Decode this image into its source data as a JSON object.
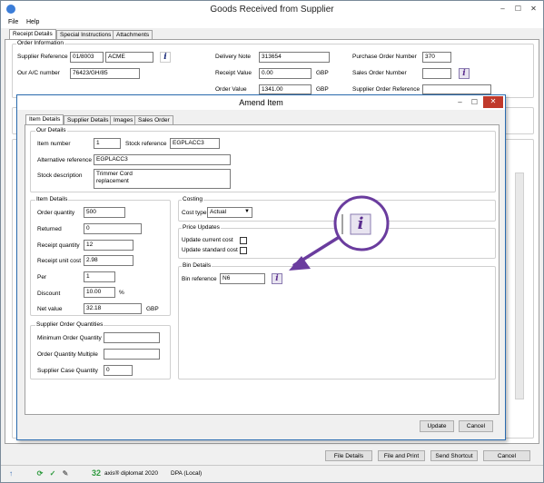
{
  "window": {
    "title": "Goods Received from Supplier",
    "minimize": "–",
    "maximize": "☐",
    "close": "✕"
  },
  "menu": [
    "File",
    "Help"
  ],
  "tabs": [
    "Receipt Details",
    "Special Instructions",
    "Attachments"
  ],
  "order_info": {
    "group_title": "Order Information",
    "supplier_reference_label": "Supplier Reference",
    "supplier_reference_code": "01/8003",
    "supplier_reference_name": "ACME",
    "our_ac_label": "Our A/C number",
    "our_ac_value": "76423/GH/85",
    "delivery_note_label": "Delivery Note",
    "delivery_note_value": "313654",
    "receipt_value_label": "Receipt Value",
    "receipt_value_value": "0.00",
    "receipt_value_ccy": "GBP",
    "order_value_label": "Order Value",
    "order_value_value": "1341.00",
    "order_value_ccy": "GBP",
    "po_number_label": "Purchase Order Number",
    "po_number_value": "370",
    "sales_order_label": "Sales Order Number",
    "sales_order_value": "",
    "supplier_order_ref_label": "Supplier Order Reference",
    "supplier_order_ref_value": ""
  },
  "buttons": {
    "file_details": "File Details",
    "file_and_print": "File and Print",
    "send_shortcut": "Send Shortcut",
    "cancel": "Cancel"
  },
  "status": {
    "count": "32",
    "product": "axis® diplomat 2020",
    "location": "DPA (Local)"
  },
  "modal": {
    "title": "Amend Item",
    "tabs": [
      "Item Details",
      "Supplier Details",
      "Images",
      "Sales Order"
    ],
    "our_details": {
      "group_title": "Our Details",
      "item_number_label": "Item number",
      "item_number_value": "1",
      "stock_reference_label": "Stock reference",
      "stock_reference_value": "EGPLACC3",
      "alt_reference_label": "Alternative reference",
      "alt_reference_value": "EGPLACC3",
      "stock_description_label": "Stock description",
      "stock_description_line1": "Trimmer Cord",
      "stock_description_line2": "replacement"
    },
    "item_details": {
      "group_title": "Item Details",
      "order_quantity_label": "Order quantity",
      "order_quantity_value": "500",
      "returned_label": "Returned",
      "returned_value": "0",
      "receipt_quantity_label": "Receipt quantity",
      "receipt_quantity_value": "12",
      "receipt_unit_cost_label": "Receipt unit cost",
      "receipt_unit_cost_value": "2.98",
      "per_label": "Per",
      "per_value": "1",
      "discount_label": "Discount",
      "discount_value": "10.00",
      "discount_unit": "%",
      "net_value_label": "Net value",
      "net_value_value": "32.18",
      "net_value_ccy": "GBP"
    },
    "supplier_quantities": {
      "group_title": "Supplier Order Quantities",
      "min_qty_label": "Minimum Order Quantity",
      "min_qty_value": "",
      "multiple_label": "Order Quantity Multiple",
      "multiple_value": "",
      "case_qty_label": "Supplier Case Quantity",
      "case_qty_value": "0"
    },
    "costing": {
      "group_title": "Costing",
      "cost_type_label": "Cost type",
      "cost_type_value": "Actual"
    },
    "price_updates": {
      "group_title": "Price Updates",
      "update_current_label": "Update current cost",
      "update_standard_label": "Update standard cost"
    },
    "bin_details": {
      "group_title": "Bin Details",
      "bin_reference_label": "Bin reference",
      "bin_reference_value": "N6"
    },
    "buttons": {
      "update": "Update",
      "cancel": "Cancel"
    }
  },
  "icons": {
    "info": "i",
    "callout": "i"
  },
  "colors": {
    "accent": "#2b6cb0",
    "callout": "#6a3c9e",
    "info_purple": "#5b2d8e"
  }
}
